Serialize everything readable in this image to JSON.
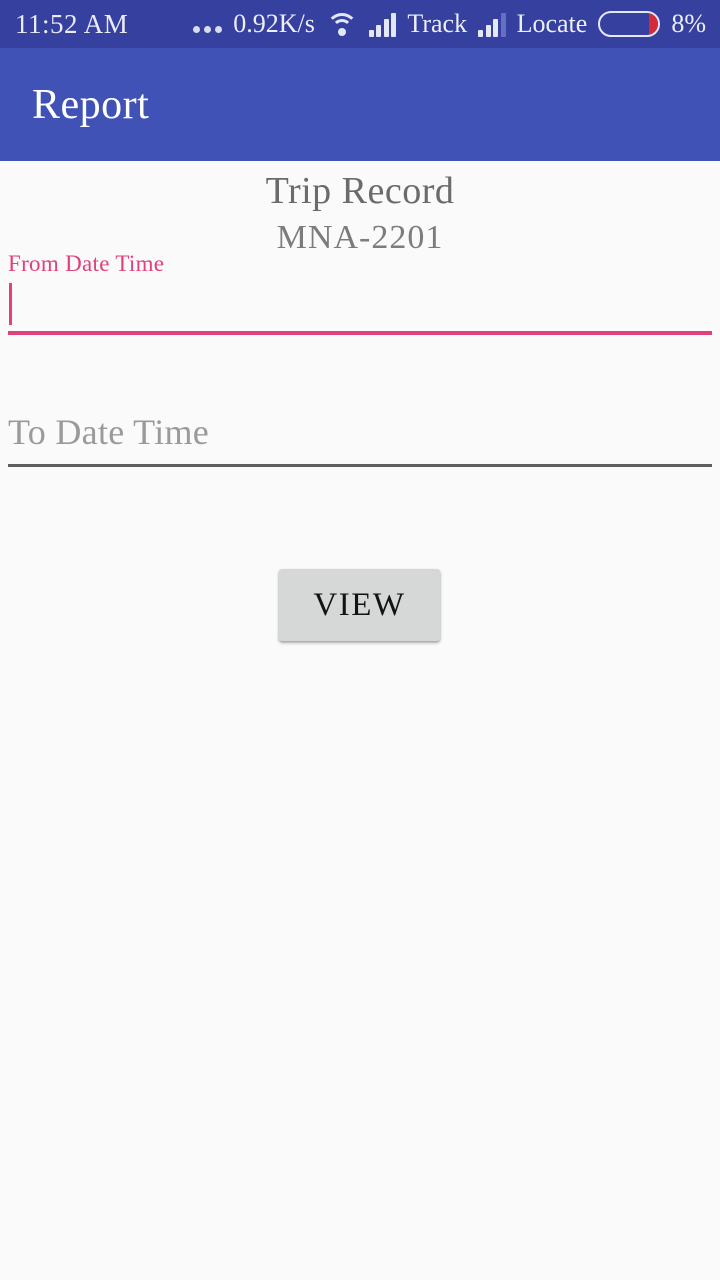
{
  "status_bar": {
    "time": "11:52 AM",
    "overflow_dots": "•••",
    "network_speed": "0.92K/s",
    "wifi_icon": "wifi-icon",
    "signal_icon_1": "signal-bars-icon",
    "carrier_1": "Track",
    "signal_icon_2": "signal-bars-icon",
    "carrier_2": "Locate",
    "battery_icon": "battery-icon",
    "battery_percent": "8%",
    "background_color": "#36409E",
    "text_color": "#EDEFF9",
    "battery_fill_color": "#D32B3A"
  },
  "app_bar": {
    "title": "Report",
    "background_color": "#4052B5",
    "title_color": "#FFFFFF"
  },
  "content": {
    "heading": "Trip Record",
    "subheading": "MNA-2201",
    "heading_color": "#6B6B6B",
    "background_color": "#FAFAFA"
  },
  "form": {
    "from_field": {
      "label": "From Date Time",
      "value": "",
      "placeholder": "From Date Time",
      "focused": true,
      "accent_color": "#E2407B"
    },
    "to_field": {
      "label": "To Date Time",
      "value": "",
      "placeholder": "To Date Time",
      "focused": false,
      "placeholder_color": "#9A9A9A",
      "underline_color": "#5E5E5E"
    },
    "view_button": {
      "label": "VIEW",
      "background_color": "#D6D7D7",
      "text_color": "#131313"
    }
  }
}
